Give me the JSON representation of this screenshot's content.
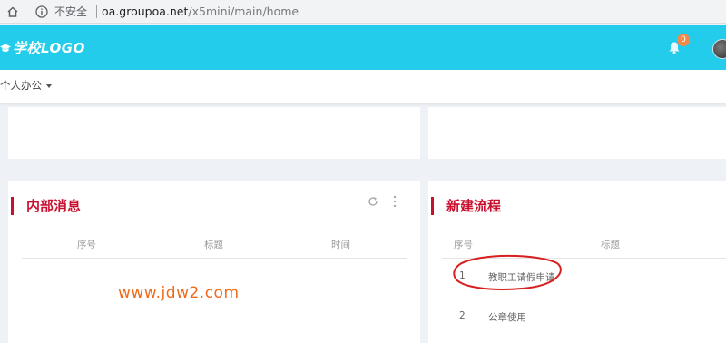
{
  "browser": {
    "security_label": "不安全",
    "url_host": "oa.groupoa.net",
    "url_path": "/x5mini/main/home"
  },
  "header": {
    "logo_text": "学校LOGO",
    "notification_count": "0",
    "accent_color": "#22ccea"
  },
  "nav": {
    "menu_label": "个人办公"
  },
  "panels": {
    "internal_messages": {
      "title": "内部消息",
      "columns": [
        "序号",
        "标题",
        "时间"
      ],
      "rows": []
    },
    "new_process": {
      "title": "新建流程",
      "columns": [
        "序号",
        "标题"
      ],
      "rows": [
        {
          "index": "1",
          "title": "教职工请假申请"
        },
        {
          "index": "2",
          "title": "公章使用"
        }
      ]
    }
  },
  "watermark": "www.jdw2.com",
  "colors": {
    "title_red": "#c8102e",
    "watermark_orange": "#f06a1a"
  }
}
